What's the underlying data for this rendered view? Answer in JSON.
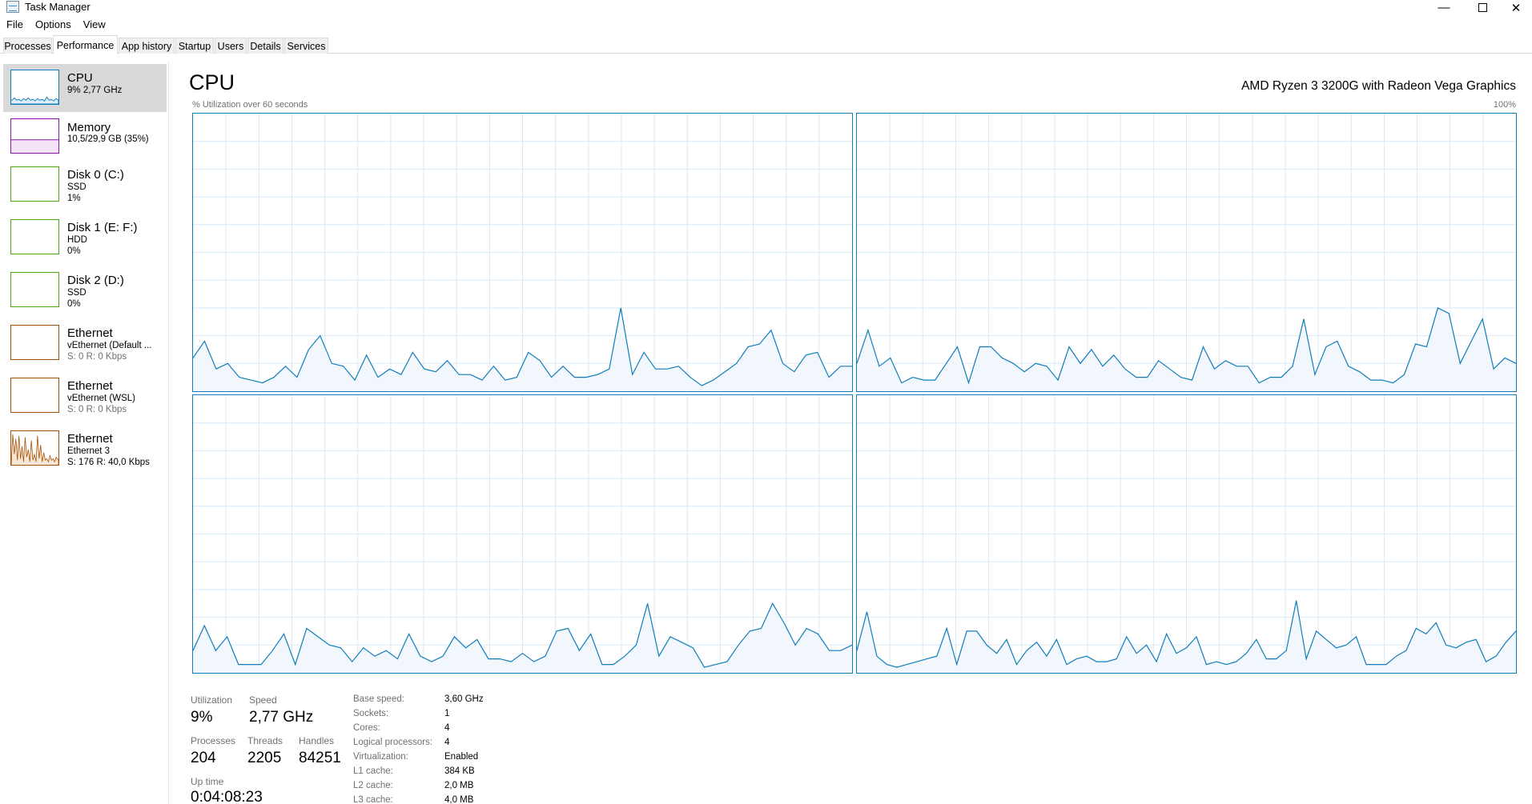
{
  "window": {
    "title": "Task Manager",
    "minimize": "—",
    "close": "✕"
  },
  "menu": [
    "File",
    "Options",
    "View"
  ],
  "tabs": [
    "Processes",
    "Performance",
    "App history",
    "Startup",
    "Users",
    "Details",
    "Services"
  ],
  "sidebar": [
    {
      "name": "CPU",
      "lines": [
        "9%  2,77 GHz"
      ],
      "color": "#117dbb",
      "selected": true
    },
    {
      "name": "Memory",
      "lines": [
        "10,5/29,9 GB (35%)"
      ],
      "color": "#8b12ae"
    },
    {
      "name": "Disk 0 (C:)",
      "lines": [
        "SSD",
        "1%"
      ],
      "color": "#4da60c"
    },
    {
      "name": "Disk 1 (E: F:)",
      "lines": [
        "HDD",
        "0%"
      ],
      "color": "#4da60c"
    },
    {
      "name": "Disk 2 (D:)",
      "lines": [
        "SSD",
        "0%"
      ],
      "color": "#4da60c"
    },
    {
      "name": "Ethernet",
      "lines": [
        "vEthernet (Default ...",
        "S: 0  R: 0 Kbps"
      ],
      "color": "#a74f01"
    },
    {
      "name": "Ethernet",
      "lines": [
        "vEthernet (WSL)",
        "S: 0  R: 0 Kbps"
      ],
      "color": "#a74f01"
    },
    {
      "name": "Ethernet",
      "lines": [
        "Ethernet 3",
        "S: 176  R: 40,0 Kbps"
      ],
      "color": "#a74f01"
    }
  ],
  "main": {
    "title": "CPU",
    "cpu_model": "AMD Ryzen 3 3200G with Radeon Vega Graphics",
    "graph_label": "% Utilization over 60 seconds",
    "graph_max": "100%",
    "line_color": "#117dbb"
  },
  "stats": {
    "utilization_label": "Utilization",
    "utilization": "9%",
    "speed_label": "Speed",
    "speed": "2,77 GHz",
    "processes_label": "Processes",
    "processes": "204",
    "threads_label": "Threads",
    "threads": "2205",
    "handles_label": "Handles",
    "handles": "84251",
    "uptime_label": "Up time",
    "uptime": "0:04:08:23"
  },
  "specs": [
    {
      "label": "Base speed:",
      "value": "3,60 GHz"
    },
    {
      "label": "Sockets:",
      "value": "1"
    },
    {
      "label": "Cores:",
      "value": "4"
    },
    {
      "label": "Logical processors:",
      "value": "4"
    },
    {
      "label": "Virtualization:",
      "value": "Enabled"
    },
    {
      "label": "L1 cache:",
      "value": "384 KB"
    },
    {
      "label": "L2 cache:",
      "value": "2,0 MB"
    },
    {
      "label": "L3 cache:",
      "value": "4,0 MB"
    }
  ],
  "core_history_percent": [
    [
      12,
      18,
      8,
      10,
      5,
      4,
      3,
      5,
      9,
      5,
      15,
      20,
      10,
      9,
      4,
      13,
      5,
      8,
      6,
      14,
      8,
      7,
      11,
      6,
      6,
      4,
      9,
      4,
      5,
      14,
      11,
      5,
      9,
      5,
      5,
      6,
      8,
      30,
      6,
      14,
      8,
      8,
      9,
      5,
      2,
      4,
      7,
      10,
      16,
      17,
      22,
      10,
      7,
      13,
      14,
      5,
      9,
      9
    ],
    [
      10,
      22,
      9,
      12,
      3,
      5,
      4,
      4,
      10,
      16,
      3,
      16,
      16,
      12,
      10,
      7,
      10,
      9,
      4,
      16,
      10,
      15,
      9,
      13,
      8,
      5,
      5,
      11,
      8,
      5,
      4,
      16,
      8,
      11,
      9,
      9,
      3,
      5,
      5,
      9,
      26,
      6,
      16,
      18,
      9,
      7,
      4,
      4,
      3,
      6,
      17,
      16,
      30,
      28,
      10,
      18,
      26,
      8,
      12,
      10
    ],
    [
      8,
      17,
      8,
      13,
      3,
      3,
      3,
      8,
      14,
      3,
      16,
      13,
      10,
      9,
      4,
      9,
      6,
      8,
      5,
      14,
      6,
      4,
      6,
      13,
      9,
      12,
      5,
      5,
      4,
      7,
      4,
      6,
      15,
      16,
      8,
      14,
      3,
      3,
      6,
      10,
      25,
      6,
      13,
      11,
      9,
      2,
      3,
      4,
      10,
      15,
      16,
      25,
      18,
      10,
      16,
      14,
      8,
      8,
      10
    ],
    [
      8,
      22,
      6,
      3,
      2,
      3,
      4,
      5,
      6,
      16,
      3,
      15,
      15,
      10,
      7,
      12,
      3,
      8,
      11,
      6,
      12,
      3,
      5,
      6,
      4,
      4,
      5,
      13,
      7,
      10,
      4,
      14,
      7,
      9,
      13,
      3,
      4,
      3,
      4,
      7,
      12,
      5,
      5,
      8,
      26,
      5,
      15,
      12,
      9,
      10,
      13,
      3,
      3,
      3,
      6,
      8,
      16,
      14,
      18,
      10,
      9,
      11,
      12,
      4,
      6,
      11,
      15
    ]
  ]
}
